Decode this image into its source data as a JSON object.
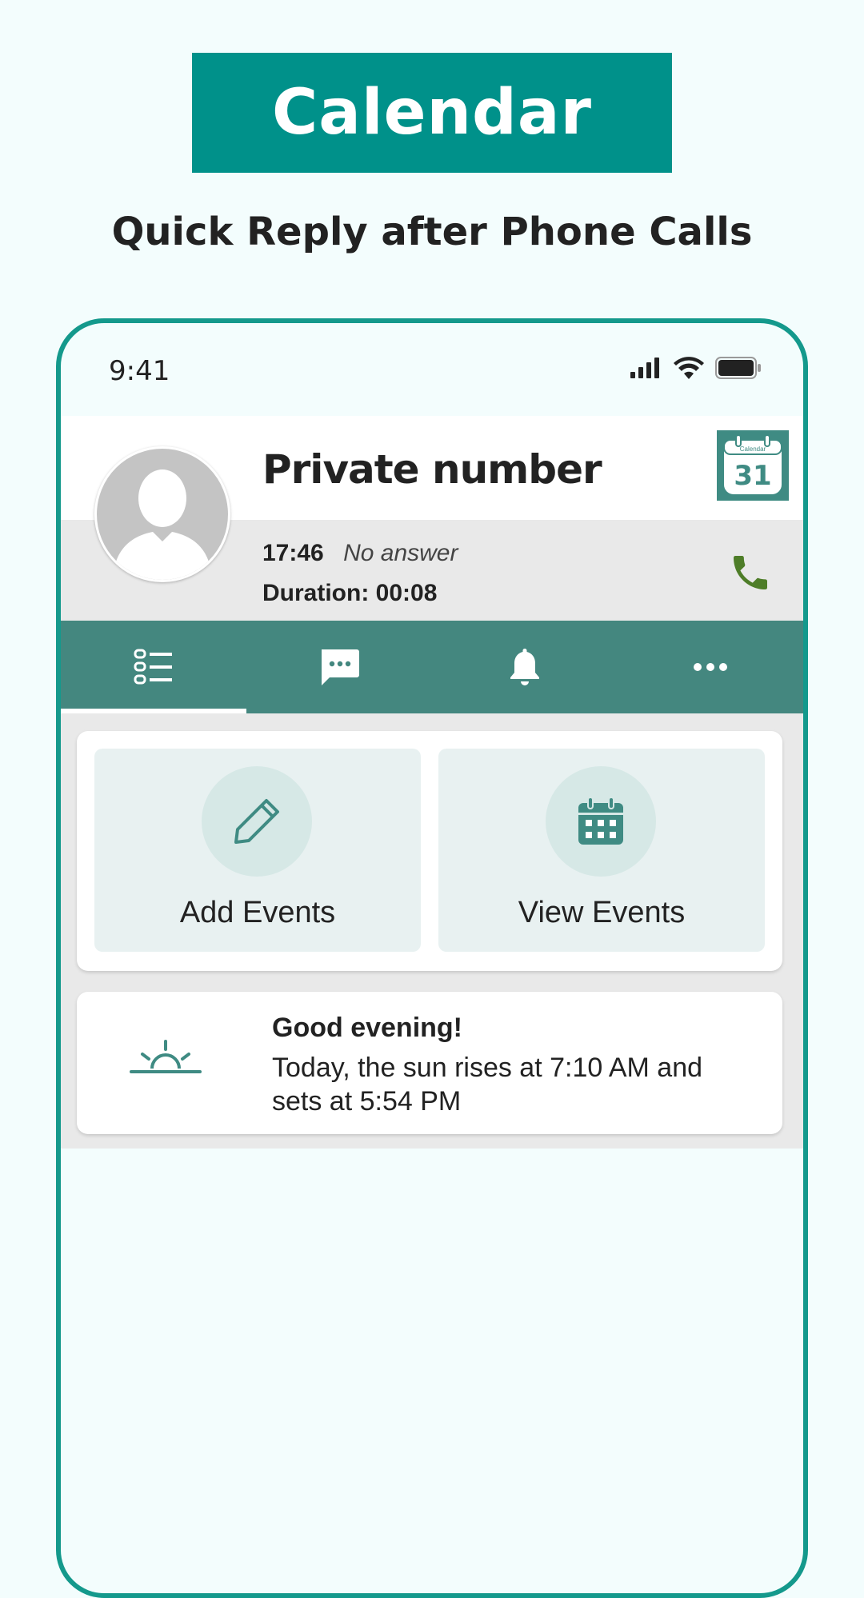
{
  "banner": {
    "title": "Calendar"
  },
  "subtitle": "Quick Reply after Phone Calls",
  "status_bar": {
    "time": "9:41"
  },
  "caller": {
    "name": "Private number",
    "time": "17:46",
    "status": "No answer",
    "duration": "Duration: 00:08",
    "calendar_badge_label": "Calendar",
    "calendar_badge_day": "31"
  },
  "tabs": [
    {
      "icon": "list-icon",
      "selected": true
    },
    {
      "icon": "message-icon",
      "selected": false
    },
    {
      "icon": "bell-icon",
      "selected": false
    },
    {
      "icon": "more-icon",
      "selected": false
    }
  ],
  "actions": {
    "add_events": "Add Events",
    "view_events": "View Events"
  },
  "greeting": {
    "title": "Good evening!",
    "text": "Today, the sun rises at 7:10 AM and sets at 5:54 PM"
  },
  "colors": {
    "brand": "#00918a",
    "tab_bar": "#44877f",
    "phone_frame": "#14998c",
    "call_icon": "#4e7d28"
  }
}
